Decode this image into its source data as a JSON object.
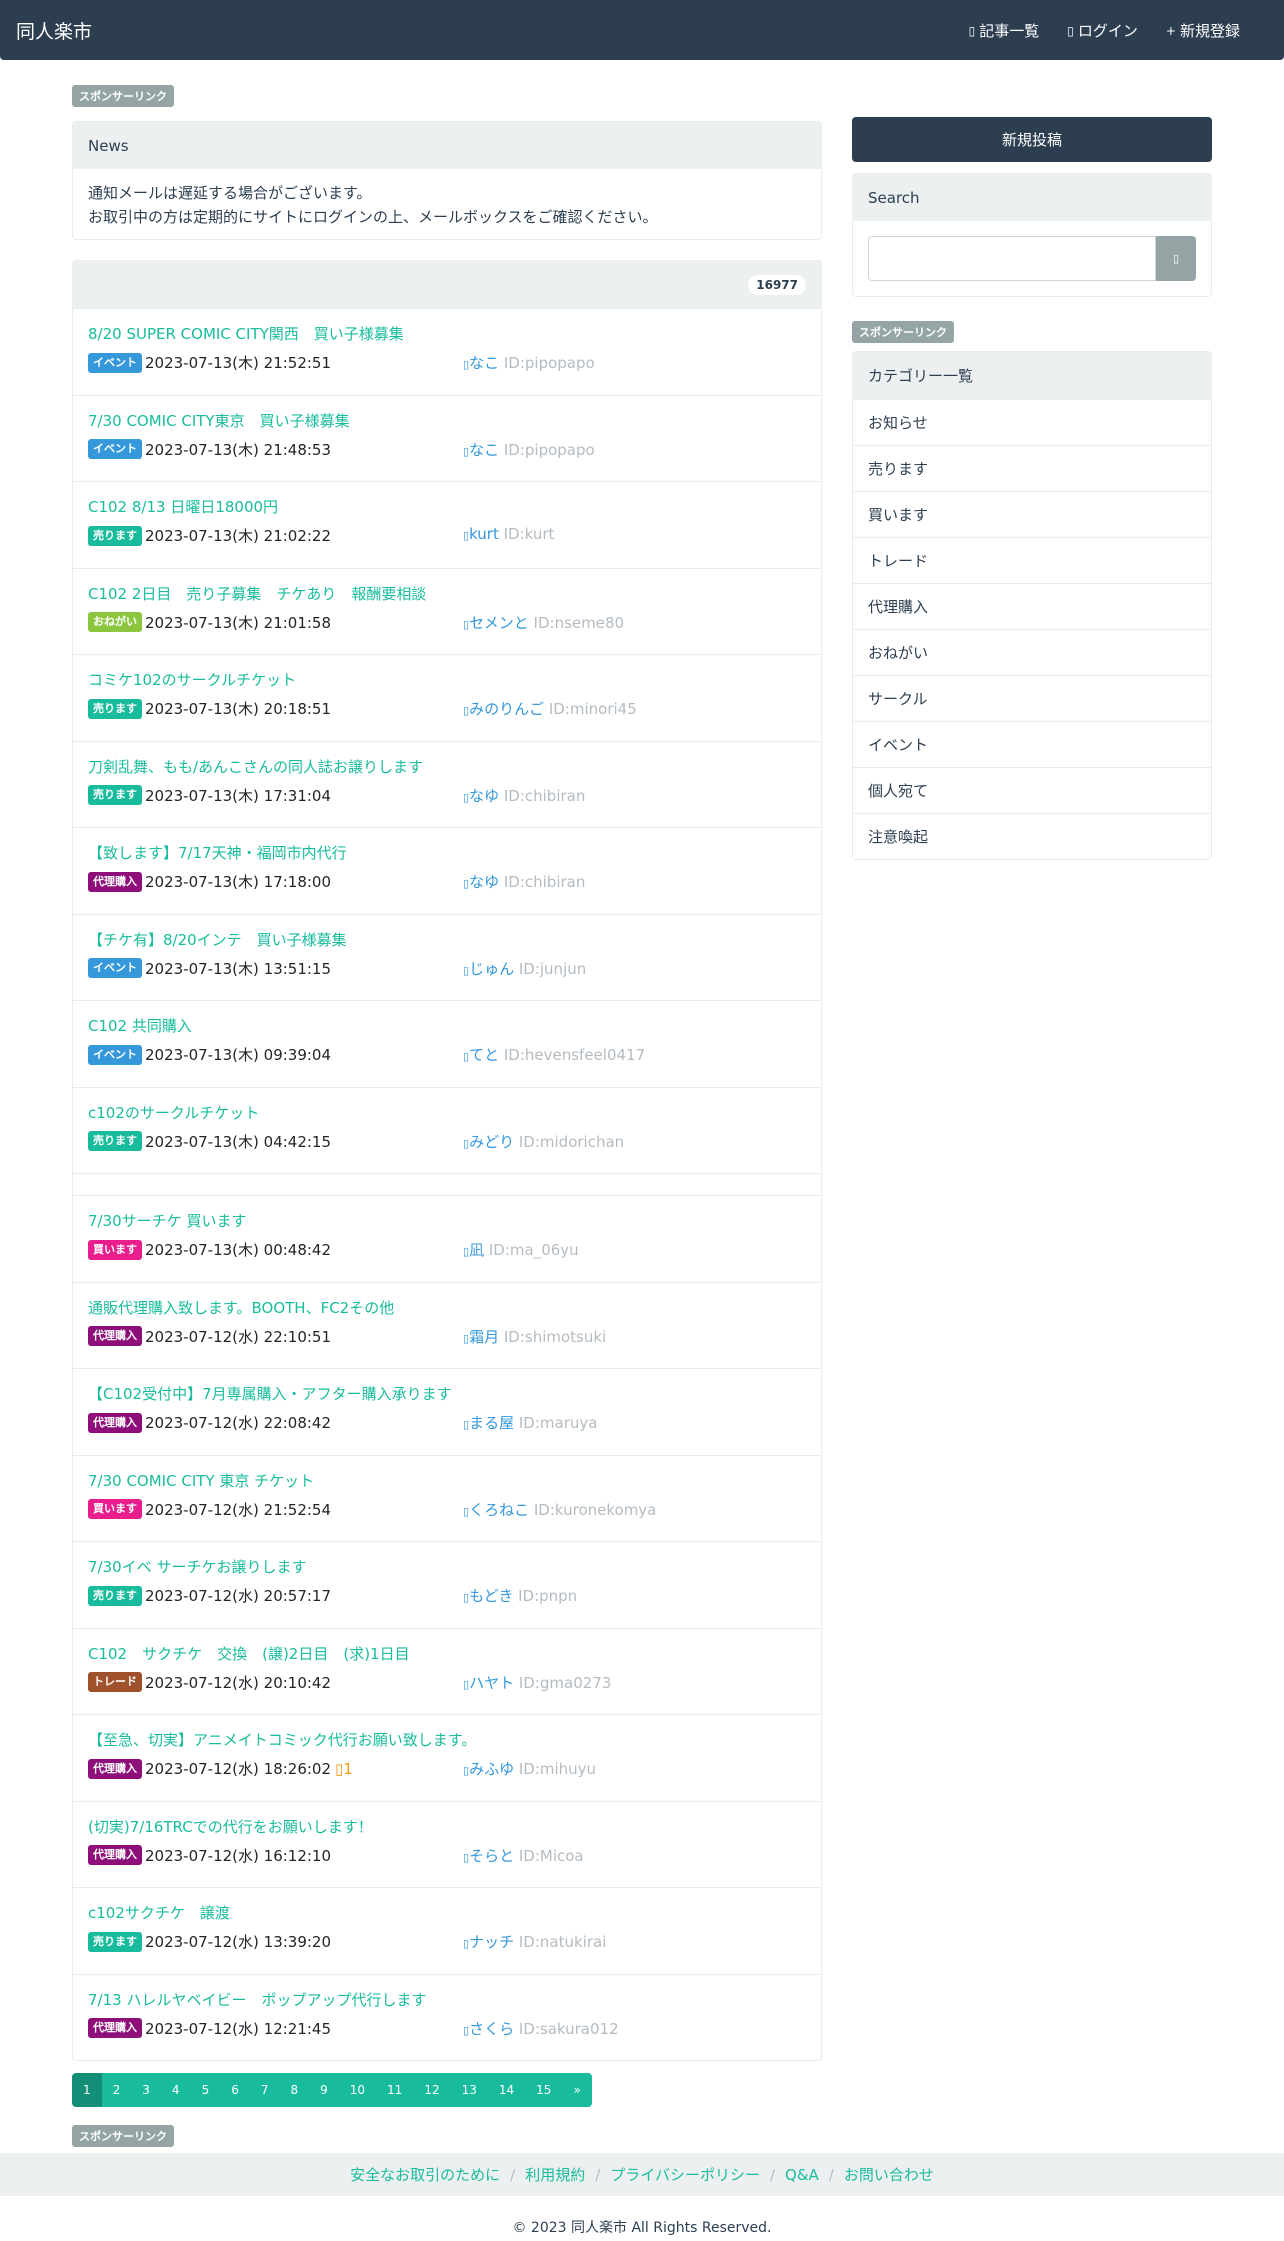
{
  "site": {
    "brand": "同人楽市"
  },
  "nav": [
    {
      "icon": "list-icon",
      "glyph": "▯",
      "label": "記事一覧"
    },
    {
      "icon": "login-icon",
      "glyph": "▯",
      "label": "ログイン"
    },
    {
      "icon": "plus-icon",
      "glyph": "+",
      "label": "新規登録"
    }
  ],
  "sponsor_label": "スポンサーリンク",
  "news": {
    "title": "News",
    "line1": "通知メールは遅延する場合がございます。",
    "line2": "お取引中の方は定期的にサイトにログインの上、メールボックスをご確認ください。"
  },
  "post_count": "16977",
  "colors": {
    "イベント": "#3498db",
    "売ります": "#18bc9c",
    "買います": "#e91e8c",
    "おねがい": "#8cc63f",
    "代理購入": "#8e0f7a",
    "トレード": "#a0522d"
  },
  "posts": [
    {
      "title": "8/20 SUPER COMIC CITY関西　買い子様募集",
      "cat": "イベント",
      "date": "2023-07-13(木) 21:52:51",
      "user": "なこ",
      "uid": "ID:pipopapo"
    },
    {
      "title": "7/30 COMIC CITY東京　買い子様募集",
      "cat": "イベント",
      "date": "2023-07-13(木) 21:48:53",
      "user": "なこ",
      "uid": "ID:pipopapo"
    },
    {
      "title": "C102 8/13 日曜日18000円",
      "cat": "売ります",
      "date": "2023-07-13(木) 21:02:22",
      "user": "kurt",
      "uid": "ID:kurt"
    },
    {
      "title": "C102 2日目　売り子募集　チケあり　報酬要相談",
      "cat": "おねがい",
      "date": "2023-07-13(木) 21:01:58",
      "user": "セメンと",
      "uid": "ID:nseme80"
    },
    {
      "title": "コミケ102のサークルチケット",
      "cat": "売ります",
      "date": "2023-07-13(木) 20:18:51",
      "user": "みのりんご",
      "uid": "ID:minori45"
    },
    {
      "title": "刀剣乱舞、もも/あんこさんの同人誌お譲りします",
      "cat": "売ります",
      "date": "2023-07-13(木) 17:31:04",
      "user": "なゆ",
      "uid": "ID:chibiran"
    },
    {
      "title": "【致します】7/17天神・福岡市内代行",
      "cat": "代理購入",
      "date": "2023-07-13(木) 17:18:00",
      "user": "なゆ",
      "uid": "ID:chibiran"
    },
    {
      "title": "【チケ有】8/20インテ　買い子様募集",
      "cat": "イベント",
      "date": "2023-07-13(木) 13:51:15",
      "user": "じゅん",
      "uid": "ID:junjun"
    },
    {
      "title": "C102 共同購入",
      "cat": "イベント",
      "date": "2023-07-13(木) 09:39:04",
      "user": "てと",
      "uid": "ID:hevensfeel0417"
    },
    {
      "title": "c102のサークルチケット",
      "cat": "売ります",
      "date": "2023-07-13(木) 04:42:15",
      "user": "みどり",
      "uid": "ID:midorichan"
    },
    {
      "empty": true
    },
    {
      "title": "7/30サーチケ 買います",
      "cat": "買います",
      "date": "2023-07-13(木) 00:48:42",
      "user": "凪",
      "uid": "ID:ma_06yu"
    },
    {
      "title": "通販代理購入致します。BOOTH、FC2その他",
      "cat": "代理購入",
      "date": "2023-07-12(水) 22:10:51",
      "user": "霜月",
      "uid": "ID:shimotsuki"
    },
    {
      "title": "【C102受付中】7月専属購入・アフター購入承ります",
      "cat": "代理購入",
      "date": "2023-07-12(水) 22:08:42",
      "user": "まる屋",
      "uid": "ID:maruya"
    },
    {
      "title": "7/30 COMIC CITY 東京 チケット",
      "cat": "買います",
      "date": "2023-07-12(水) 21:52:54",
      "user": "くろねこ",
      "uid": "ID:kuronekomya"
    },
    {
      "title": "7/30イベ サーチケお譲りします",
      "cat": "売ります",
      "date": "2023-07-12(水) 20:57:17",
      "user": "もどき",
      "uid": "ID:pnpn"
    },
    {
      "title": "C102　サクチケ　交換　(譲)2日目　(求)1日目",
      "cat": "トレード",
      "date": "2023-07-12(水) 20:10:42",
      "user": "ハヤト",
      "uid": "ID:gma0273"
    },
    {
      "title": "【至急、切実】アニメイトコミック代行お願い致します。",
      "cat": "代理購入",
      "date": "2023-07-12(水) 18:26:02",
      "warn": "1",
      "user": "みふゆ",
      "uid": "ID:mihuyu"
    },
    {
      "title": "(切実)7/16TRCでの代行をお願いします！",
      "cat": "代理購入",
      "date": "2023-07-12(水) 16:12:10",
      "user": "そらと",
      "uid": "ID:Micoa"
    },
    {
      "title": "c102サクチケ　譲渡",
      "cat": "売ります",
      "date": "2023-07-12(水) 13:39:20",
      "user": "ナッチ",
      "uid": "ID:natukirai"
    },
    {
      "title": "7/13 ハレルヤベイビー　ポップアップ代行します",
      "cat": "代理購入",
      "date": "2023-07-12(水) 12:21:45",
      "user": "さくら",
      "uid": "ID:sakura012"
    }
  ],
  "pagination": [
    "1",
    "2",
    "3",
    "4",
    "5",
    "6",
    "7",
    "8",
    "9",
    "10",
    "11",
    "12",
    "13",
    "14",
    "15",
    "»"
  ],
  "sidebar": {
    "new_post": "新規投稿",
    "search_title": "Search",
    "search_button_glyph": "▯",
    "categories_title": "カテゴリー一覧",
    "categories": [
      "お知らせ",
      "売ります",
      "買います",
      "トレード",
      "代理購入",
      "おねがい",
      "サークル",
      "イベント",
      "個人宛て",
      "注意喚起"
    ]
  },
  "footer": {
    "links": [
      "安全なお取引のために",
      "利用規約",
      "プライバシーポリシー",
      "Q&A",
      "お問い合わせ"
    ],
    "copyright": "© 2023 同人楽市 All Rights Reserved."
  }
}
